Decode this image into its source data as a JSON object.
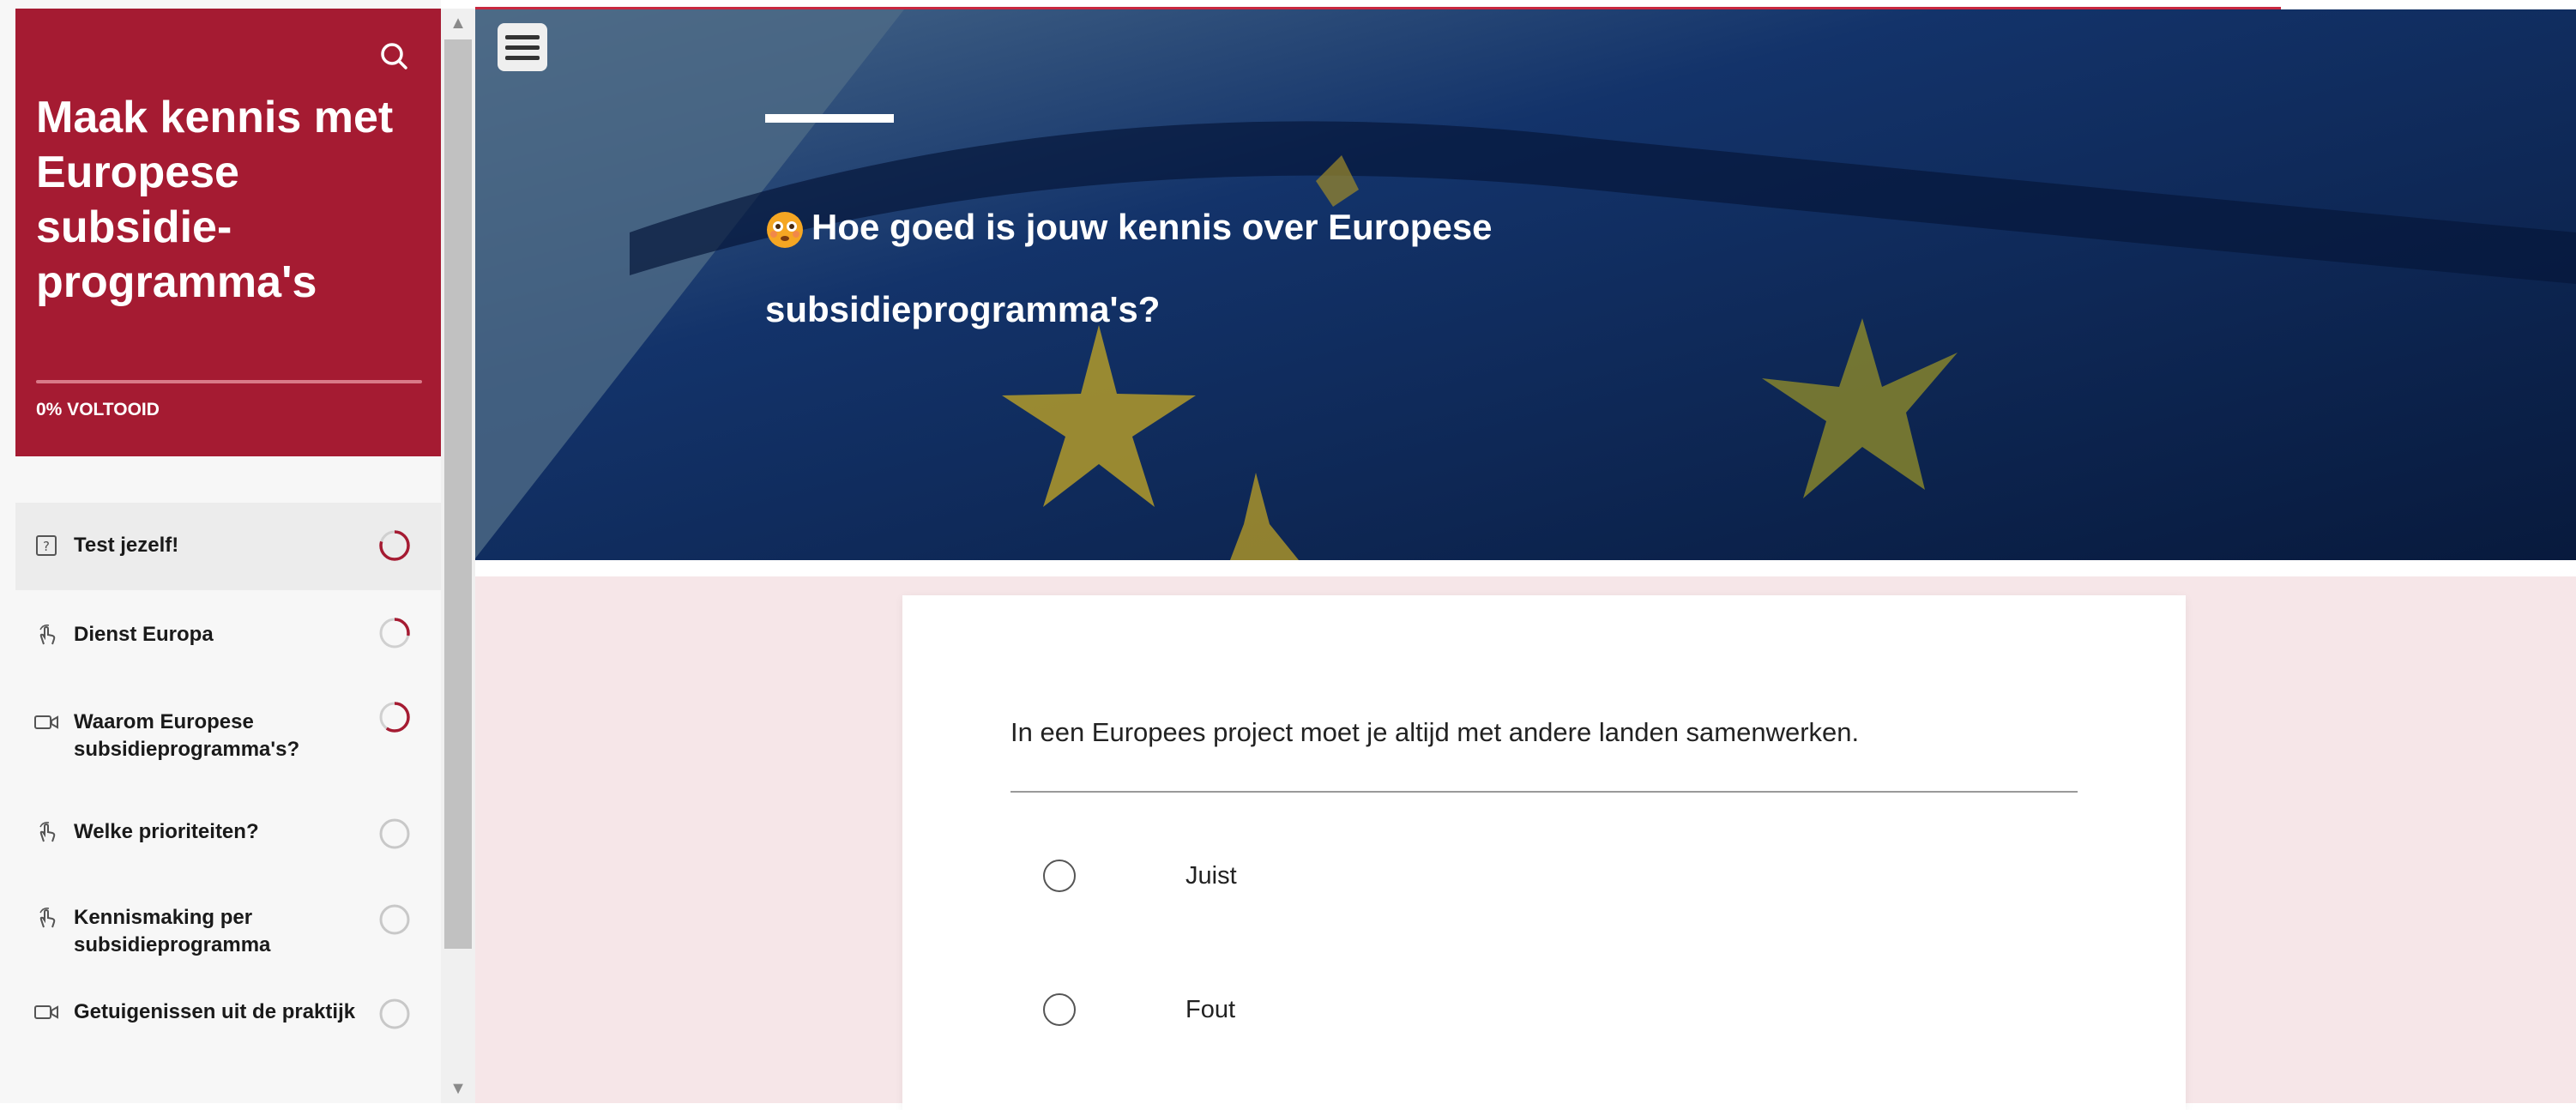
{
  "course": {
    "title": "Maak kennis met Europese subsidie-programma's",
    "progress_label": "0% VOLTOOID",
    "progress_percent": 0
  },
  "sidebar": {
    "search_icon": "search-icon",
    "lessons": [
      {
        "label": "Test jezelf!",
        "icon": "quiz-icon",
        "status": "in-progress",
        "active": true
      },
      {
        "label": "Dienst Europa",
        "icon": "touch-icon",
        "status": "in-progress",
        "active": false
      },
      {
        "label": "Waarom Europese subsidieprogramma's?",
        "icon": "video-icon",
        "status": "in-progress",
        "active": false
      },
      {
        "label": "Welke prioriteiten?",
        "icon": "touch-icon",
        "status": "not-started",
        "active": false
      },
      {
        "label": "Kennismaking per subsidieprogramma",
        "icon": "touch-icon",
        "status": "not-started",
        "active": false
      },
      {
        "label": "Getuigenissen uit de praktijk",
        "icon": "video-icon",
        "status": "not-started",
        "active": false
      }
    ]
  },
  "hero": {
    "title": "Hoe goed is jouw kennis over Europese subsidieprogramma's?",
    "emoji_icon": "flushed-face-icon",
    "menu_icon": "hamburger-menu-icon"
  },
  "quiz": {
    "question": "In een Europees project moet je altijd met andere landen samenwerken.",
    "options": [
      {
        "label": "Juist",
        "selected": false
      },
      {
        "label": "Fout",
        "selected": false
      }
    ]
  },
  "colors": {
    "brand": "#a51b32",
    "content_bg": "#f6e6e8",
    "hero_bg": "#0e2a5a"
  }
}
